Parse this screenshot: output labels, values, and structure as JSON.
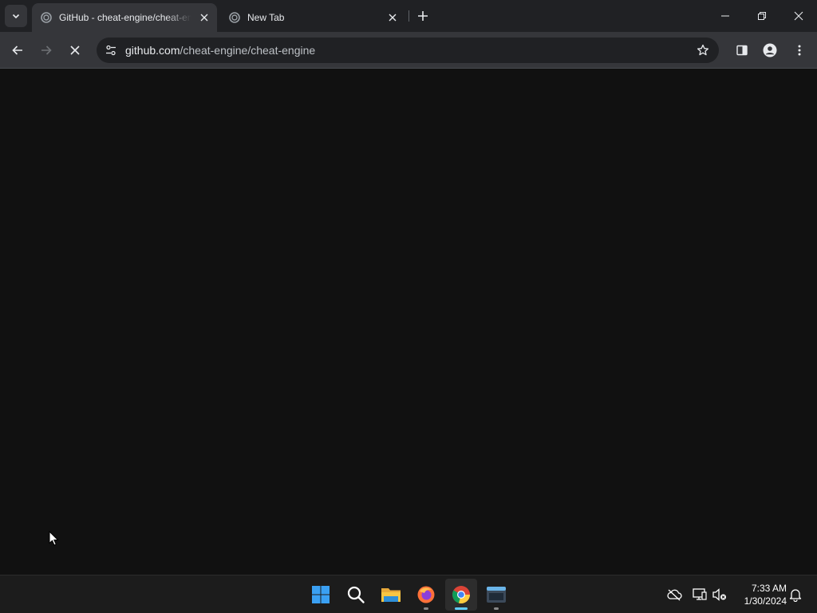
{
  "browser": {
    "tabs": [
      {
        "title": "GitHub - cheat-engine/cheat-engine",
        "active": true,
        "favicon": "loading-spinner-icon"
      },
      {
        "title": "New Tab",
        "active": false,
        "favicon": "loading-spinner-icon"
      }
    ],
    "omnibox": {
      "url_host": "github.com",
      "url_path": "/cheat-engine/cheat-engine"
    }
  },
  "taskbar": {
    "apps": [
      {
        "name": "start",
        "icon": "windows-start-icon"
      },
      {
        "name": "search",
        "icon": "search-icon"
      },
      {
        "name": "file-explorer",
        "icon": "folder-icon"
      },
      {
        "name": "firefox",
        "icon": "firefox-icon"
      },
      {
        "name": "chrome",
        "icon": "chrome-icon"
      },
      {
        "name": "terminal",
        "icon": "terminal-icon"
      }
    ],
    "clock": {
      "time": "7:33 AM",
      "date": "1/30/2024"
    }
  },
  "colors": {
    "tabstrip_bg": "#202124",
    "toolbar_bg": "#35363a",
    "content_bg": "#111111",
    "taskbar_bg": "#1c1c1c",
    "accent": "#60cdff"
  }
}
